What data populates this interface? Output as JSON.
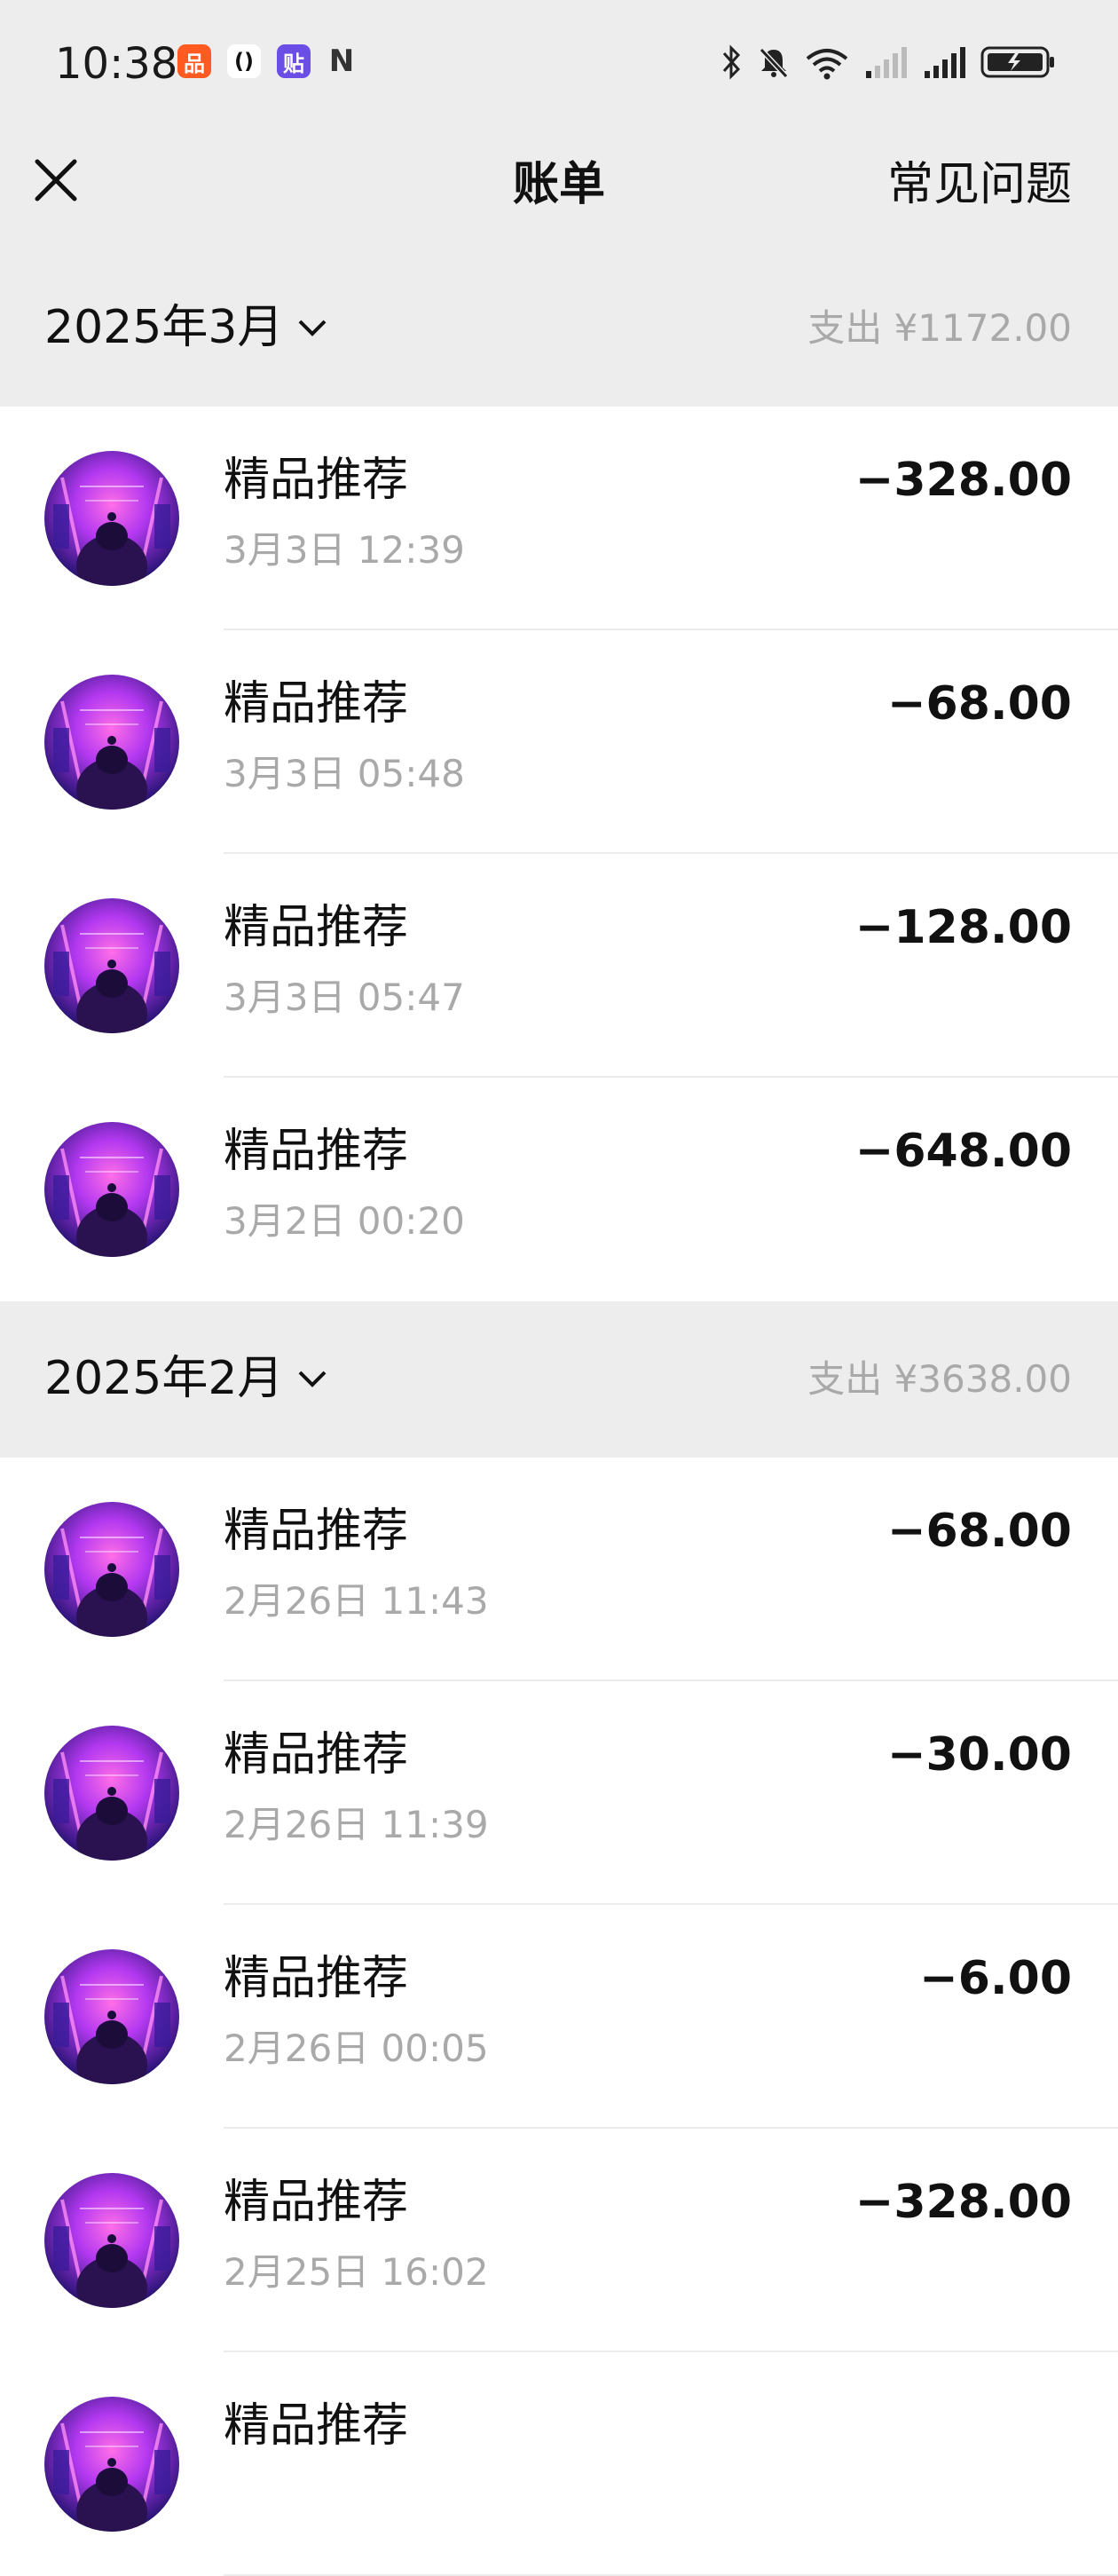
{
  "status_bar": {
    "time": "10:38",
    "app_icons": [
      {
        "icon": "xiaohongshu-app-icon",
        "color": "#ff5a1f",
        "glyph": "品"
      },
      {
        "icon": "bracket-app-icon",
        "color": "#ffffff",
        "glyph": "()"
      },
      {
        "icon": "tieba-app-icon",
        "color": "#6b4ee6",
        "glyph": "贴"
      },
      {
        "icon": "nfc-icon",
        "color": "#333333",
        "glyph": "N"
      }
    ],
    "system_icons": [
      "bluetooth-icon",
      "mute-icon",
      "wifi-icon",
      "signal-1-icon",
      "signal-2-icon",
      "battery-charging-icon"
    ]
  },
  "header": {
    "title": "账单",
    "faq_label": "常见问题"
  },
  "months": [
    {
      "label": "2025年3月",
      "total": "支出 ¥1172.00",
      "transactions": [
        {
          "title": "精品推荐",
          "time": "3月3日 12:39",
          "amount": "−328.00"
        },
        {
          "title": "精品推荐",
          "time": "3月3日 05:48",
          "amount": "−68.00"
        },
        {
          "title": "精品推荐",
          "time": "3月3日 05:47",
          "amount": "−128.00"
        },
        {
          "title": "精品推荐",
          "time": "3月2日 00:20",
          "amount": "−648.00"
        }
      ]
    },
    {
      "label": "2025年2月",
      "total": "支出 ¥3638.00",
      "transactions": [
        {
          "title": "精品推荐",
          "time": "2月26日 11:43",
          "amount": "−68.00"
        },
        {
          "title": "精品推荐",
          "time": "2月26日 11:39",
          "amount": "−30.00"
        },
        {
          "title": "精品推荐",
          "time": "2月26日 00:05",
          "amount": "−6.00"
        },
        {
          "title": "精品推荐",
          "time": "2月25日 16:02",
          "amount": "−328.00"
        },
        {
          "title": "精品推荐",
          "time": "",
          "amount": ""
        }
      ]
    }
  ],
  "colors": {
    "header_bg": "#ededed",
    "secondary_text": "#a9a9a9",
    "avatar_purple": "#7b2cf0",
    "avatar_pink": "#ff3fd0"
  }
}
